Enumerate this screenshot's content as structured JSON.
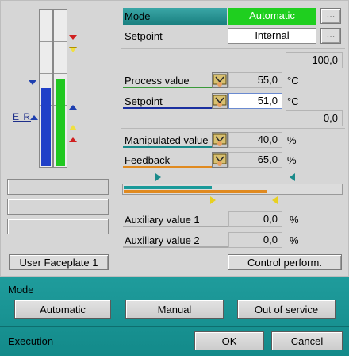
{
  "mode": {
    "label": "Mode",
    "value": "Automatic",
    "dots": "..."
  },
  "setpoint_source": {
    "label": "Setpoint",
    "value": "Internal",
    "dots": "..."
  },
  "scale": {
    "high": "100,0",
    "low": "0,0"
  },
  "process_value": {
    "label": "Process value",
    "value": "55,0",
    "unit": "°C",
    "level": 0.55
  },
  "setpoint": {
    "label": "Setpoint",
    "value": "51,0",
    "unit": "°C"
  },
  "manipulated_value": {
    "label": "Manipulated value",
    "value": "40,0",
    "unit": "%",
    "level": 0.4
  },
  "feedback": {
    "label": "Feedback",
    "value": "65,0",
    "unit": "%",
    "level": 0.65
  },
  "aux1": {
    "label": "Auxiliary value 1",
    "value": "0,0",
    "unit": "%"
  },
  "aux2": {
    "label": "Auxiliary value 2",
    "value": "0,0",
    "unit": "%"
  },
  "left_panel": {
    "er": "E R"
  },
  "buttons": {
    "user_faceplate": "User Faceplate 1",
    "control_perform": "Control perform."
  },
  "mode_panel": {
    "title": "Mode",
    "automatic": "Automatic",
    "manual": "Manual",
    "out_of_service": "Out of service"
  },
  "execution": {
    "title": "Execution",
    "ok": "OK",
    "cancel": "Cancel"
  },
  "colors": {
    "mode_active": "#1fcf1f",
    "process_value": "#3a9a3a",
    "setpoint": "#1a2fa0",
    "manipulated": "#1a8a8a",
    "feedback": "#e08a20",
    "panel_teal": "#1a9494"
  }
}
